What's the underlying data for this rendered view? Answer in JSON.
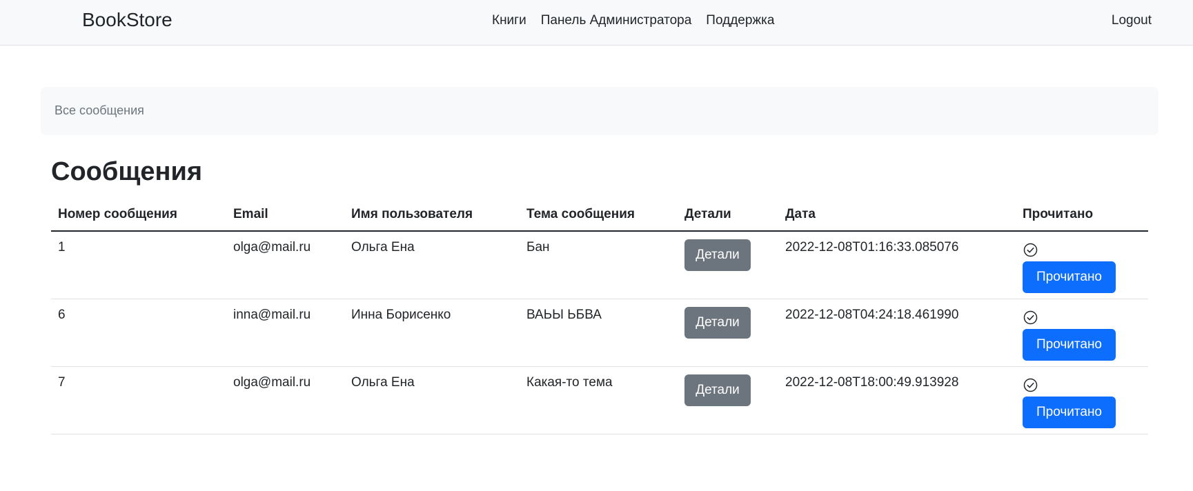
{
  "navbar": {
    "brand": "BookStore",
    "links": [
      "Книги",
      "Панель Администратора",
      "Поддержка"
    ],
    "logout": "Logout"
  },
  "breadcrumb": "Все сообщения",
  "page_title": "Сообщения",
  "table": {
    "headers": [
      "Номер сообщения",
      "Email",
      "Имя пользователя",
      "Тема сообщения",
      "Детали",
      "Дата",
      "Прочитано"
    ],
    "details_label": "Детали",
    "read_label": "Прочитано",
    "rows": [
      {
        "id": "1",
        "email": "olga@mail.ru",
        "name": "Ольга Ена",
        "subject": "Бан",
        "date": "2022-12-08T01:16:33.085076"
      },
      {
        "id": "6",
        "email": "inna@mail.ru",
        "name": "Инна Борисенко",
        "subject": "ВАЬЫ ЬБВА",
        "date": "2022-12-08T04:24:18.461990"
      },
      {
        "id": "7",
        "email": "olga@mail.ru",
        "name": "Ольга Ена",
        "subject": "Какая-то тема",
        "date": "2022-12-08T18:00:49.913928"
      }
    ]
  },
  "icons": {
    "read_status": "check-circle-icon"
  },
  "colors": {
    "primary": "#0d6efd",
    "secondary": "#6c757d",
    "navbar_bg": "#f8f9fa"
  }
}
